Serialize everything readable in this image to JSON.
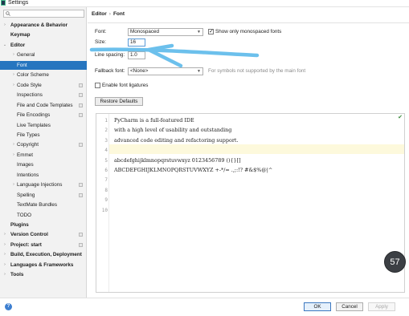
{
  "window": {
    "title": "Settings"
  },
  "sidebar": {
    "search_placeholder": "",
    "items": [
      {
        "label": "Appearance & Behavior",
        "bold": true,
        "arrow": "›"
      },
      {
        "label": "Keymap",
        "bold": true,
        "arrow": ""
      },
      {
        "label": "Editor",
        "bold": true,
        "arrow": "⌄"
      },
      {
        "label": "General",
        "bold": false,
        "arrow": "›"
      },
      {
        "label": "Font",
        "bold": false,
        "arrow": "",
        "selected": true
      },
      {
        "label": "Color Scheme",
        "bold": false,
        "arrow": "›"
      },
      {
        "label": "Code Style",
        "bold": false,
        "arrow": "›",
        "project": true
      },
      {
        "label": "Inspections",
        "bold": false,
        "arrow": "",
        "project": true
      },
      {
        "label": "File and Code Templates",
        "bold": false,
        "arrow": "",
        "project": true
      },
      {
        "label": "File Encodings",
        "bold": false,
        "arrow": "",
        "project": true
      },
      {
        "label": "Live Templates",
        "bold": false,
        "arrow": ""
      },
      {
        "label": "File Types",
        "bold": false,
        "arrow": ""
      },
      {
        "label": "Copyright",
        "bold": false,
        "arrow": "›",
        "project": true
      },
      {
        "label": "Emmet",
        "bold": false,
        "arrow": "›"
      },
      {
        "label": "Images",
        "bold": false,
        "arrow": ""
      },
      {
        "label": "Intentions",
        "bold": false,
        "arrow": ""
      },
      {
        "label": "Language Injections",
        "bold": false,
        "arrow": "›",
        "project": true
      },
      {
        "label": "Spelling",
        "bold": false,
        "arrow": "",
        "project": true
      },
      {
        "label": "TextMate Bundles",
        "bold": false,
        "arrow": ""
      },
      {
        "label": "TODO",
        "bold": false,
        "arrow": ""
      },
      {
        "label": "Plugins",
        "bold": true,
        "arrow": ""
      },
      {
        "label": "Version Control",
        "bold": true,
        "arrow": "›",
        "project": true
      },
      {
        "label": "Project: start",
        "bold": true,
        "arrow": "›",
        "project": true
      },
      {
        "label": "Build, Execution, Deployment",
        "bold": true,
        "arrow": "›"
      },
      {
        "label": "Languages & Frameworks",
        "bold": true,
        "arrow": "›"
      },
      {
        "label": "Tools",
        "bold": true,
        "arrow": "›"
      }
    ]
  },
  "breadcrumb": {
    "parent": "Editor",
    "separator": "›",
    "current": "Font"
  },
  "form": {
    "font_label": "Font:",
    "font_value": "Monospaced",
    "show_mono_label": "Show only monospaced fonts",
    "show_mono_checked": true,
    "size_label": "Size:",
    "size_value": "16",
    "line_spacing_label": "Line spacing:",
    "line_spacing_value": "1.0",
    "fallback_label": "Fallback font:",
    "fallback_value": "<None>",
    "fallback_hint": "For symbols not supported by the main font",
    "ligatures_label": "Enable font ligatures",
    "ligatures_checked": false,
    "restore_button": "Restore Defaults"
  },
  "preview": {
    "lines": [
      "PyCharm is a full-featured IDE",
      "with a high level of usability and outstanding",
      "advanced code editing and refactoring support.",
      "",
      "abcdefghijklmnopqrstuvwxyz 0123456789 (){}[]",
      "ABCDEFGHIJKLMNOPQRSTUVWXYZ +-*/= .,;:!? #&$%@|^",
      "",
      "",
      "",
      ""
    ],
    "line_numbers": [
      "1",
      "2",
      "3",
      "4",
      "5",
      "6",
      "7",
      "8",
      "9",
      "10"
    ]
  },
  "footer": {
    "help": "?",
    "ok": "OK",
    "cancel": "Cancel",
    "apply": "Apply"
  },
  "overlay": {
    "badge": "57"
  },
  "colors": {
    "selection": "#2675bf",
    "annotation_arrow": "#6cc0ec",
    "current_line": "#fdf9dc"
  }
}
